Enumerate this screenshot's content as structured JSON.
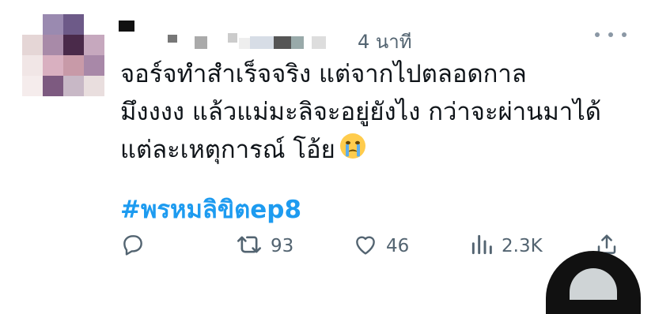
{
  "tweet": {
    "time_label": "4 นาที",
    "lines": [
      "จอร์จทำสำเร็จจริง แต่จากไปตลอดกาล",
      "มึงงงง แล้วแม่มะลิจะอยู่ยังไง กว่าจะผ่านมาได้",
      "แต่ละเหตุการณ์ โอ้ย"
    ],
    "hashtag": "#พรหมลิขิตep8"
  },
  "actions": {
    "retweets": "93",
    "likes": "46",
    "views": "2.3K"
  },
  "colors": {
    "hashtag": "#1d9bf0",
    "muted": "#536471",
    "text": "#0f1419"
  },
  "icons": [
    "reply-icon",
    "retweet-icon",
    "like-icon",
    "views-icon",
    "share-icon",
    "more-icon",
    "crying-emoji"
  ]
}
